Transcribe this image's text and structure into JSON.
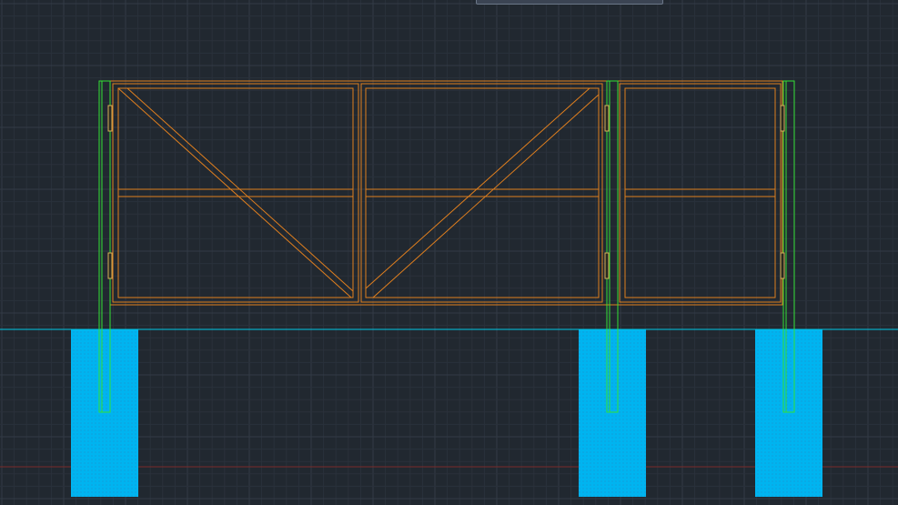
{
  "app": {
    "kind": "cad-model-space-viewport"
  },
  "colors": {
    "background": "#212830",
    "grid_minor": "#2a313b",
    "grid_major": "#323a46",
    "ground_line": "#00c8e6",
    "axis_line": "#7a2a2a",
    "gate_frame": "#e07f1e",
    "post": "#33e034",
    "hinge": "#d9b25a",
    "footing": "#00b4f0",
    "footing_dots": "#2a7fb8",
    "top_panel": "#3b4453"
  },
  "drawing": {
    "layers": [
      "gate-frame",
      "posts",
      "hinges",
      "footings",
      "ground-line",
      "grid"
    ],
    "panels": [
      {
        "name": "gate-leaf-left",
        "has_diagonal_brace": true,
        "brace_direction": "down-right"
      },
      {
        "name": "gate-leaf-right",
        "has_diagonal_brace": true,
        "brace_direction": "up-right"
      },
      {
        "name": "wicket-gate",
        "has_diagonal_brace": false
      }
    ],
    "posts_count": 3,
    "footings_count": 3,
    "hinges_count": 6
  }
}
